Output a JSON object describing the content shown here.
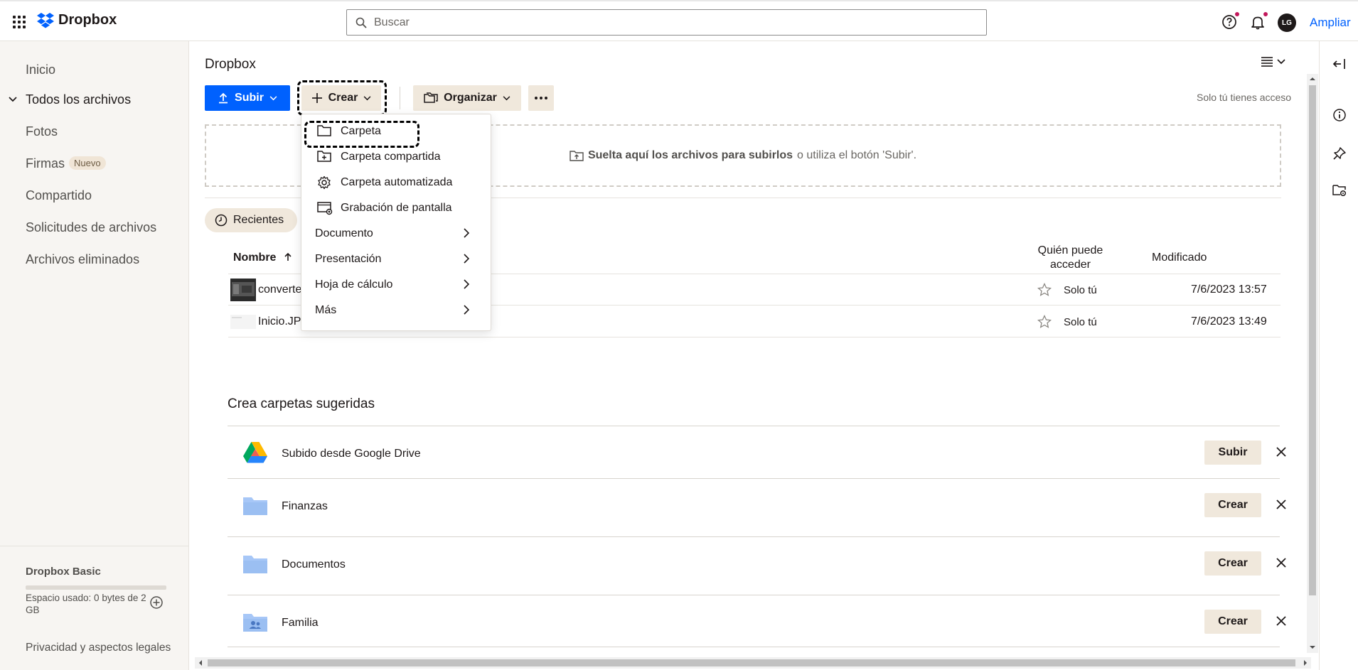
{
  "topbar": {
    "brand": "Dropbox",
    "search_placeholder": "Buscar",
    "avatar_initials": "LG",
    "upgrade_label": "Ampliar"
  },
  "sidebar": {
    "items": [
      {
        "label": "Inicio"
      },
      {
        "label": "Todos los archivos"
      },
      {
        "label": "Fotos"
      },
      {
        "label": "Firmas",
        "badge": "Nuevo"
      },
      {
        "label": "Compartido"
      },
      {
        "label": "Solicitudes de archivos"
      },
      {
        "label": "Archivos eliminados"
      }
    ],
    "plan_title": "Dropbox Basic",
    "plan_usage": "Espacio usado: 0 bytes de 2 GB",
    "legal": "Privacidad y aspectos legales"
  },
  "main": {
    "breadcrumb": "Dropbox",
    "upload_label": "Subir",
    "create_label": "Crear",
    "organize_label": "Organizar",
    "access_note": "Solo tú tienes acceso",
    "dropzone_bold": "Suelta aquí los archivos para subirlos",
    "dropzone_rest": "o utiliza el botón 'Subir'.",
    "recent_chip": "Recientes",
    "columns": {
      "name": "Nombre",
      "who": "Quién puede acceder",
      "modified": "Modificado"
    },
    "files": [
      {
        "name": "converte",
        "who": "Solo tú",
        "modified": "7/6/2023 13:57"
      },
      {
        "name": "Inicio.JP",
        "who": "Solo tú",
        "modified": "7/6/2023 13:49"
      }
    ],
    "suggest_title": "Crea carpetas sugeridas",
    "suggestions": [
      {
        "label": "Subido desde Google Drive",
        "action": "Subir",
        "icon": "google-drive-icon"
      },
      {
        "label": "Finanzas",
        "action": "Crear",
        "icon": "folder-icon"
      },
      {
        "label": "Documentos",
        "action": "Crear",
        "icon": "folder-icon"
      },
      {
        "label": "Familia",
        "action": "Crear",
        "icon": "shared-folder-icon"
      }
    ]
  },
  "create_menu": {
    "items": [
      {
        "label": "Carpeta",
        "icon": "folder-icon"
      },
      {
        "label": "Carpeta compartida",
        "icon": "shared-folder-icon"
      },
      {
        "label": "Carpeta automatizada",
        "icon": "gear-icon"
      },
      {
        "label": "Grabación de pantalla",
        "icon": "screen-record-icon"
      },
      {
        "label": "Documento"
      },
      {
        "label": "Presentación"
      },
      {
        "label": "Hoja de cálculo"
      },
      {
        "label": "Más"
      }
    ]
  },
  "colors": {
    "accent": "#0061fe",
    "button_bg": "#f0e8dc",
    "sidebar_bg": "#f7f5f2"
  }
}
